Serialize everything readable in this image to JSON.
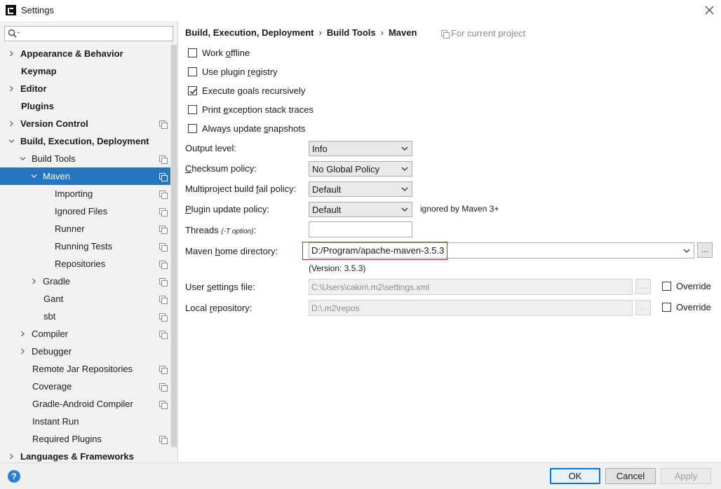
{
  "window": {
    "title": "Settings"
  },
  "search": {
    "placeholder": ""
  },
  "sidebar": {
    "items": [
      {
        "label": "Appearance & Behavior",
        "bold": true,
        "expand": "collapsed",
        "indent": 0,
        "project": false
      },
      {
        "label": "Keymap",
        "bold": true,
        "expand": "none",
        "indent": 0,
        "project": false
      },
      {
        "label": "Editor",
        "bold": true,
        "expand": "collapsed",
        "indent": 0,
        "project": false
      },
      {
        "label": "Plugins",
        "bold": true,
        "expand": "none",
        "indent": 0,
        "project": false
      },
      {
        "label": "Version Control",
        "bold": true,
        "expand": "collapsed",
        "indent": 0,
        "project": true
      },
      {
        "label": "Build, Execution, Deployment",
        "bold": true,
        "expand": "expanded",
        "indent": 0,
        "project": false
      },
      {
        "label": "Build Tools",
        "bold": false,
        "expand": "expanded",
        "indent": 1,
        "project": true
      },
      {
        "label": "Maven",
        "bold": false,
        "expand": "expanded",
        "indent": 2,
        "project": true,
        "selected": true
      },
      {
        "label": "Importing",
        "bold": false,
        "expand": "none",
        "indent": 3,
        "project": true
      },
      {
        "label": "Ignored Files",
        "bold": false,
        "expand": "none",
        "indent": 3,
        "project": true
      },
      {
        "label": "Runner",
        "bold": false,
        "expand": "none",
        "indent": 3,
        "project": true
      },
      {
        "label": "Running Tests",
        "bold": false,
        "expand": "none",
        "indent": 3,
        "project": true
      },
      {
        "label": "Repositories",
        "bold": false,
        "expand": "none",
        "indent": 3,
        "project": true
      },
      {
        "label": "Gradle",
        "bold": false,
        "expand": "collapsed",
        "indent": 2,
        "project": true
      },
      {
        "label": "Gant",
        "bold": false,
        "expand": "none",
        "indent": 2,
        "project": true
      },
      {
        "label": "sbt",
        "bold": false,
        "expand": "none",
        "indent": 2,
        "project": true
      },
      {
        "label": "Compiler",
        "bold": false,
        "expand": "collapsed",
        "indent": 1,
        "project": true
      },
      {
        "label": "Debugger",
        "bold": false,
        "expand": "collapsed",
        "indent": 1,
        "project": false
      },
      {
        "label": "Remote Jar Repositories",
        "bold": false,
        "expand": "none",
        "indent": 1,
        "project": true
      },
      {
        "label": "Coverage",
        "bold": false,
        "expand": "none",
        "indent": 1,
        "project": true
      },
      {
        "label": "Gradle-Android Compiler",
        "bold": false,
        "expand": "none",
        "indent": 1,
        "project": true
      },
      {
        "label": "Instant Run",
        "bold": false,
        "expand": "none",
        "indent": 1,
        "project": false
      },
      {
        "label": "Required Plugins",
        "bold": false,
        "expand": "none",
        "indent": 1,
        "project": true
      },
      {
        "label": "Languages & Frameworks",
        "bold": true,
        "expand": "collapsed",
        "indent": 0,
        "project": false
      }
    ]
  },
  "breadcrumb": {
    "part1": "Build, Execution, Deployment",
    "sep": "›",
    "part2": "Build Tools",
    "part3": "Maven"
  },
  "scope": {
    "label": "For current project"
  },
  "options": {
    "work_offline": {
      "pre": "Work ",
      "mnemonic": "o",
      "post": "ffline",
      "checked": false
    },
    "plugin_registry": {
      "pre": "Use plugin ",
      "mnemonic": "r",
      "post": "egistry",
      "checked": false
    },
    "execute_goals": {
      "pre": "Execute ",
      "mnemonic": "g",
      "post": "oals recursively",
      "checked": true
    },
    "print_exception": {
      "pre": "Print ",
      "mnemonic": "e",
      "post": "xception stack traces",
      "checked": false
    },
    "update_snapshots": {
      "pre": "Always update ",
      "mnemonic": "s",
      "post": "napshots",
      "checked": false
    }
  },
  "form": {
    "output_level": {
      "label": "Output level:",
      "value": "Info"
    },
    "checksum_policy": {
      "pre": "",
      "mnemonic": "C",
      "post": "hecksum policy:",
      "value": "No Global Policy"
    },
    "multiproject": {
      "pre": "Multiproject build ",
      "mnemonic": "f",
      "post": "ail policy:",
      "value": "Default"
    },
    "plugin_update": {
      "pre": "",
      "mnemonic": "P",
      "post": "lugin update policy:",
      "value": "Default",
      "note": "ignored by Maven 3+"
    },
    "threads": {
      "label": "Threads ",
      "hint": "(-T option)",
      "suffix": ":",
      "value": ""
    },
    "maven_home": {
      "pre": "Maven ",
      "mnemonic": "h",
      "post": "ome directory:",
      "value": "D:/Program/apache-maven-3.5.3",
      "version": "(Version: 3.5.3)"
    },
    "user_settings": {
      "pre": "User ",
      "mnemonic": "s",
      "post": "ettings file:",
      "value": "C:\\Users\\cakin\\.m2\\settings.xml",
      "override": "Override",
      "override_checked": false
    },
    "local_repo": {
      "pre": "Local ",
      "mnemonic": "r",
      "post": "epository:",
      "value": "D:\\.m2\\repos",
      "override": "Override",
      "override_checked": false
    },
    "browse": "..."
  },
  "buttons": {
    "help": "?",
    "ok": "OK",
    "cancel": "Cancel",
    "apply": "Apply"
  },
  "colors": {
    "selection": "#2675bf",
    "highlight_border": "#e01d1d",
    "help": "#2d7fd6"
  }
}
